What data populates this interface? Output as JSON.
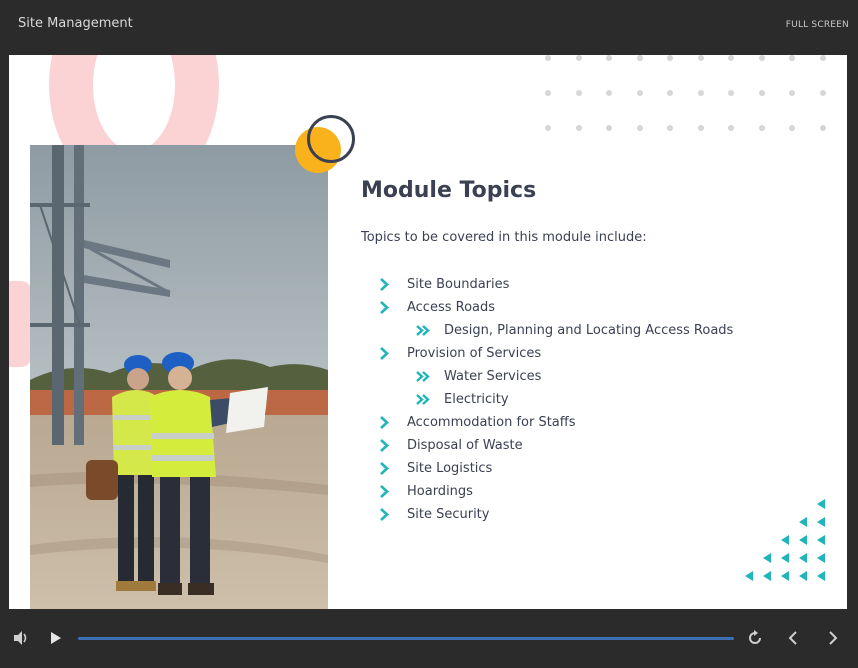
{
  "window": {
    "title": "Site Management",
    "fullscreen_label": "FULL SCREEN"
  },
  "slide": {
    "heading": "Module Topics",
    "intro": "Topics to be covered in this module include:",
    "topics": [
      {
        "label": "Site Boundaries",
        "level": 1
      },
      {
        "label": "Access Roads",
        "level": 1
      },
      {
        "label": "Design, Planning and Locating Access Roads",
        "level": 2
      },
      {
        "label": "Provision of Services",
        "level": 1
      },
      {
        "label": "Water Services",
        "level": 2
      },
      {
        "label": "Electricity",
        "level": 2
      },
      {
        "label": "Accommodation for Staffs",
        "level": 1
      },
      {
        "label": "Disposal of Waste",
        "level": 1
      },
      {
        "label": "Site Logistics",
        "level": 1
      },
      {
        "label": "Hoardings",
        "level": 1
      },
      {
        "label": "Site Security",
        "level": 1
      }
    ],
    "image": "two-construction-workers-hardhats-photo"
  },
  "player": {
    "progress_fraction": 1.0,
    "icons": [
      "volume-icon",
      "play-icon",
      "replay-icon",
      "previous-icon",
      "next-icon"
    ]
  },
  "colors": {
    "accent_teal": "#1fb5b9",
    "heading": "#3b4152",
    "pink": "#fbd3d5",
    "yellow": "#f9b21b",
    "progress": "#3d6fb5"
  }
}
